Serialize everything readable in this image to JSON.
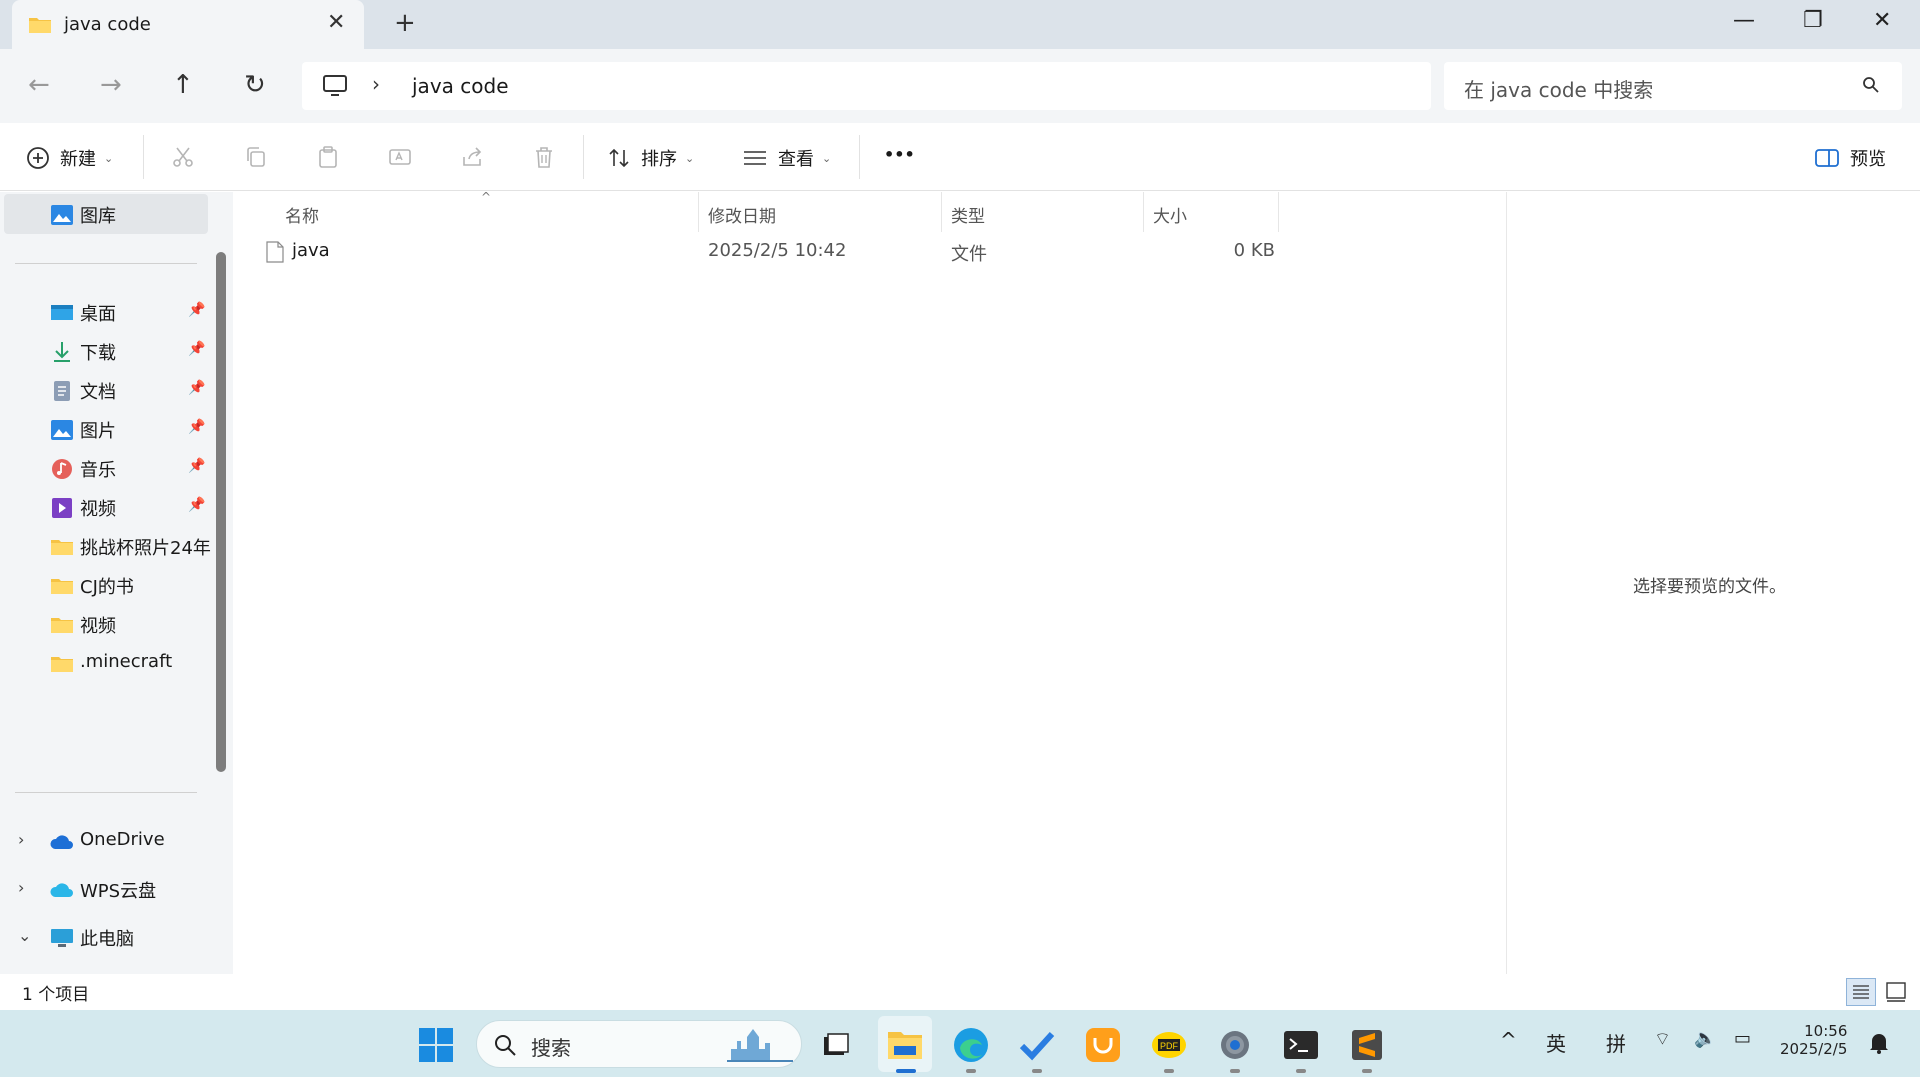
{
  "window": {
    "tab_title": "java code",
    "new_tab": "+",
    "close_tab": "✕",
    "minimize": "—",
    "restore": "❐",
    "close": "✕"
  },
  "address": {
    "path_segment": "java code",
    "separator": "›"
  },
  "search": {
    "placeholder": "在 java code 中搜索"
  },
  "toolbar": {
    "new_label": "新建",
    "sort_label": "排序",
    "view_label": "查看",
    "more_label": "•••",
    "preview_label": "预览"
  },
  "sidebar": {
    "gallery": "图库",
    "quick_access": [
      {
        "label": "桌面",
        "icon": "desktop-icon",
        "pinned": true
      },
      {
        "label": "下载",
        "icon": "download-icon",
        "pinned": true
      },
      {
        "label": "文档",
        "icon": "documents-icon",
        "pinned": true
      },
      {
        "label": "图片",
        "icon": "pictures-icon",
        "pinned": true
      },
      {
        "label": "音乐",
        "icon": "music-icon",
        "pinned": true
      },
      {
        "label": "视频",
        "icon": "videos-icon",
        "pinned": true
      },
      {
        "label": "挑战杯照片24年",
        "icon": "folder-icon",
        "pinned": false
      },
      {
        "label": "CJ的书",
        "icon": "folder-icon",
        "pinned": false
      },
      {
        "label": "视频",
        "icon": "folder-icon",
        "pinned": false
      },
      {
        "label": ".minecraft",
        "icon": "folder-icon",
        "pinned": false
      }
    ],
    "locations": [
      {
        "label": "OneDrive",
        "icon": "cloud-icon",
        "expander": "›"
      },
      {
        "label": "WPS云盘",
        "icon": "cloud-icon",
        "expander": "›"
      },
      {
        "label": "此电脑",
        "icon": "computer-icon",
        "expander": "⌄"
      }
    ]
  },
  "file_list": {
    "columns": [
      "名称",
      "修改日期",
      "类型",
      "大小"
    ],
    "rows": [
      {
        "name": "java",
        "modified": "2025/2/5 10:42",
        "type": "文件",
        "size": "0 KB"
      }
    ]
  },
  "preview": {
    "message": "选择要预览的文件。"
  },
  "status": {
    "item_count": "1 个项目"
  },
  "taskbar": {
    "search_placeholder": "搜索",
    "tray": {
      "chevron": "^",
      "ime_lang": "英",
      "ime_mode": "拼",
      "time": "10:56",
      "date": "2025/2/5"
    }
  },
  "colors": {
    "titlebar": "#dce3ea",
    "chrome": "#f3f5f7",
    "taskbar": "#d4e9ee",
    "folder_yellow": "#f6c344",
    "accent_blue": "#1f6fd1"
  }
}
